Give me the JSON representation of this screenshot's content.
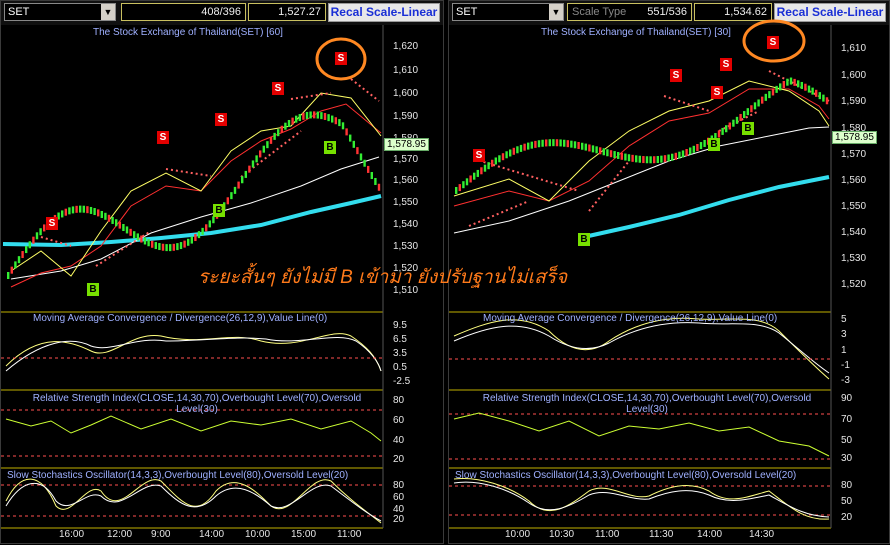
{
  "colors": {
    "sell": "#e30000",
    "buy": "#77e000",
    "ema_fast": "#ffffff",
    "ema_slow": "#ff4040",
    "ma_long": "#33ddee",
    "divider": "#c0b000",
    "annotation": "#ff7a1a"
  },
  "left": {
    "symbol": "SET",
    "counter": "408/396",
    "last_price": "1,527.27",
    "scale_button": "Recal Scale-Linear",
    "title": "The Stock Exchange of Thailand(SET) [60]",
    "price_axis": [
      "1,620",
      "1,610",
      "1,600",
      "1,590",
      "1,580",
      "1,570",
      "1,560",
      "1,550",
      "1,540",
      "1,530",
      "1,520",
      "1,510"
    ],
    "current_price": "1,578.95",
    "macd_title": "Moving Average Convergence / Divergence(26,12,9),Value Line(0)",
    "macd_axis": [
      "9.5",
      "6.5",
      "3.5",
      "0.5",
      "-2.5"
    ],
    "rsi_title": "Relative Strength Index(CLOSE,14,30,70),Overbought Level(70),Oversold Level(30)",
    "rsi_axis": [
      "80",
      "60",
      "40",
      "20"
    ],
    "stoch_title": "Slow Stochastics Oscillator(14,3,3),Overbought Level(80),Oversold Level(20)",
    "stoch_axis": [
      "80",
      "60",
      "40",
      "20"
    ],
    "time_axis": [
      "16:00",
      "12:00",
      "9:00",
      "14:00",
      "10:00",
      "15:00",
      "11:00"
    ],
    "signals": [
      "S",
      "S",
      "S",
      "S",
      "S",
      "B",
      "B",
      "B"
    ]
  },
  "right": {
    "symbol": "SET",
    "scale_type": "Scale Type",
    "counter": "551/536",
    "last_price": "1,534.62",
    "scale_button": "Recal Scale-Linear",
    "title": "The Stock Exchange of Thailand(SET) [30]",
    "price_axis": [
      "1,610",
      "1,600",
      "1,590",
      "1,580",
      "1,570",
      "1,560",
      "1,550",
      "1,540",
      "1,530",
      "1,520"
    ],
    "current_price": "1,578.95",
    "macd_title": "Moving Average Convergence / Divergence(26,12,9),Value Line(0)",
    "macd_axis": [
      "5",
      "3",
      "1",
      "-1",
      "-3"
    ],
    "rsi_title": "Relative Strength Index(CLOSE,14,30,70),Overbought Level(70),Oversold Level(30)",
    "rsi_axis": [
      "90",
      "70",
      "50",
      "30"
    ],
    "stoch_title": "Slow Stochastics Oscillator(14,3,3),Overbought Level(80),Oversold Level(20)",
    "stoch_axis": [
      "80",
      "50",
      "20"
    ],
    "time_axis": [
      "10:00",
      "10:30",
      "11:00",
      "11:30",
      "14:00",
      "14:30"
    ],
    "signals": [
      "S",
      "S",
      "S",
      "S",
      "S",
      "B",
      "B",
      "B"
    ]
  },
  "annotation": "ระยะสั้นๆ ยังไม่มี B เข้ามา ยังปรับฐานไม่เสร็จ"
}
